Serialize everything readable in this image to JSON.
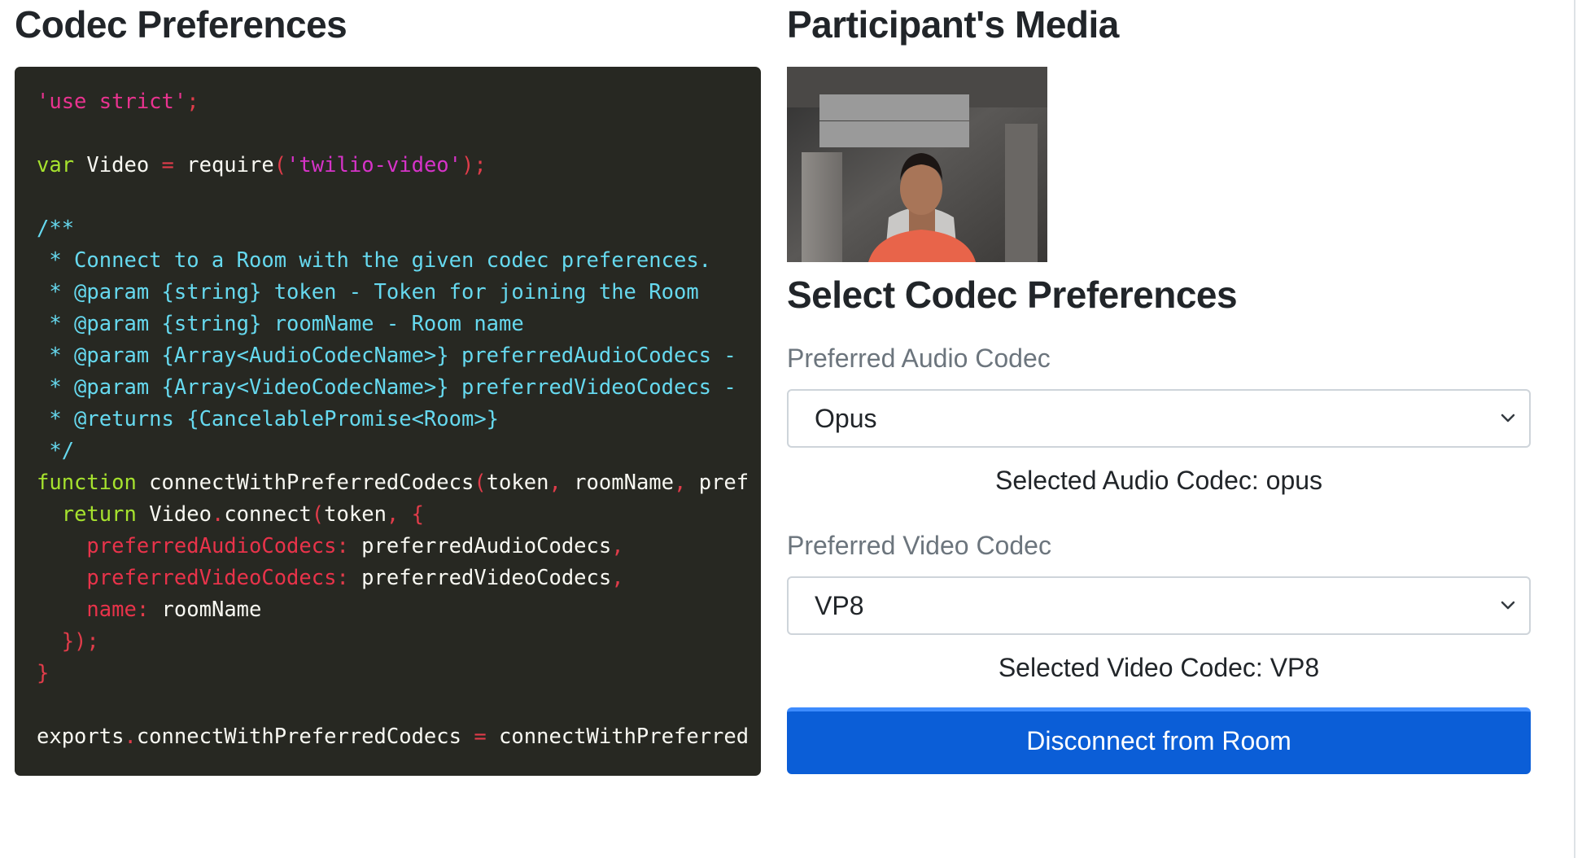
{
  "left": {
    "title": "Codec Preferences",
    "code": {
      "l1_str": "'use strict'",
      "l1_semi": ";",
      "l3_kw": "var",
      "l3_name": " Video ",
      "l3_eq": "=",
      "l3_req": " require",
      "l3_po": "(",
      "l3_str": "'twilio-video'",
      "l3_pc": ");",
      "l5": "/**",
      "l6": " * Connect to a Room with the given codec preferences.",
      "l7": " * @param {string} token - Token for joining the Room",
      "l8": " * @param {string} roomName - Room name",
      "l9": " * @param {Array<AudioCodecName>} preferredAudioCodecs -",
      "l10": " * @param {Array<VideoCodecName>} preferredVideoCodecs -",
      "l11": " * @returns {CancelablePromise<Room>}",
      "l12": " */",
      "l13_kw": "function",
      "l13_fn": " connectWithPreferredCodecs",
      "l13_po": "(",
      "l13_a1": "token",
      "l13_c1": ",",
      "l13_a2": " roomName",
      "l13_c2": ",",
      "l13_a3": " pref",
      "l14_ind": "  ",
      "l14_kw": "return",
      "l14_obj": " Video",
      "l14_dot": ".",
      "l14_fn": "connect",
      "l14_po": "(",
      "l14_a1": "token",
      "l14_c1": ",",
      "l14_br": " {",
      "l15_ind": "    ",
      "l15_key": "preferredAudioCodecs",
      "l15_col": ":",
      "l15_val": " preferredAudioCodecs",
      "l15_com": ",",
      "l16_ind": "    ",
      "l16_key": "preferredVideoCodecs",
      "l16_col": ":",
      "l16_val": " preferredVideoCodecs",
      "l16_com": ",",
      "l17_ind": "    ",
      "l17_key": "name",
      "l17_col": ":",
      "l17_val": " roomName",
      "l18": "  });",
      "l19": "}",
      "l21_obj": "exports",
      "l21_dot": ".",
      "l21_prop": "connectWithPreferredCodecs ",
      "l21_eq": "=",
      "l21_val": " connectWithPreferred"
    }
  },
  "right": {
    "title": "Participant's Media",
    "select_title": "Select Codec Preferences",
    "audio": {
      "label": "Preferred Audio Codec",
      "value": "Opus",
      "selected_text": "Selected Audio Codec: opus"
    },
    "video": {
      "label": "Preferred Video Codec",
      "value": "VP8",
      "selected_text": "Selected Video Codec: VP8"
    },
    "disconnect_label": "Disconnect from Room"
  },
  "colors": {
    "code_bg": "#272822",
    "button_bg": "#0b5ed7",
    "accent": "#3d8bfd"
  }
}
